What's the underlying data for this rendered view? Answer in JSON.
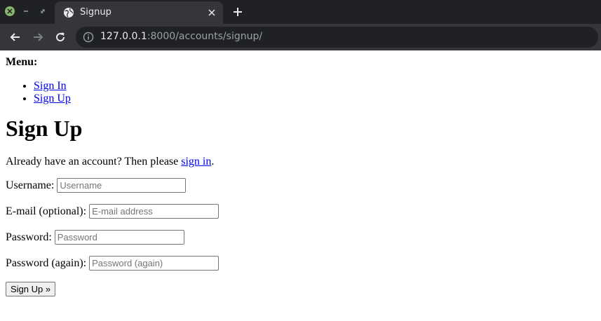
{
  "browser": {
    "tab_title": "Signup",
    "url_host": "127.0.0.1",
    "url_rest": ":8000/accounts/signup/",
    "icons": {
      "window_close": "close-icon",
      "window_minimize": "minimize-icon",
      "window_maximize": "maximize-icon",
      "tab_favicon": "globe-icon",
      "tab_close": "close-icon",
      "new_tab": "plus-icon",
      "back": "arrow-left-icon",
      "forward": "arrow-right-icon",
      "reload": "reload-icon",
      "site_info": "info-icon"
    }
  },
  "menu": {
    "title": "Menu:",
    "items": [
      {
        "label": "Sign In"
      },
      {
        "label": "Sign Up"
      }
    ]
  },
  "heading": "Sign Up",
  "intro": {
    "text_before": "Already have an account? Then please ",
    "link": "sign in",
    "text_after": "."
  },
  "form": {
    "username": {
      "label": "Username:",
      "placeholder": "Username",
      "value": ""
    },
    "email": {
      "label": "E-mail (optional):",
      "placeholder": "E-mail address",
      "value": ""
    },
    "password1": {
      "label": "Password:",
      "placeholder": "Password",
      "value": ""
    },
    "password2": {
      "label": "Password (again):",
      "placeholder": "Password (again)",
      "value": ""
    },
    "submit_label": "Sign Up »"
  },
  "colors": {
    "link": "#0000ee",
    "chrome_dark": "#202124",
    "chrome_toolbar": "#35363a"
  }
}
